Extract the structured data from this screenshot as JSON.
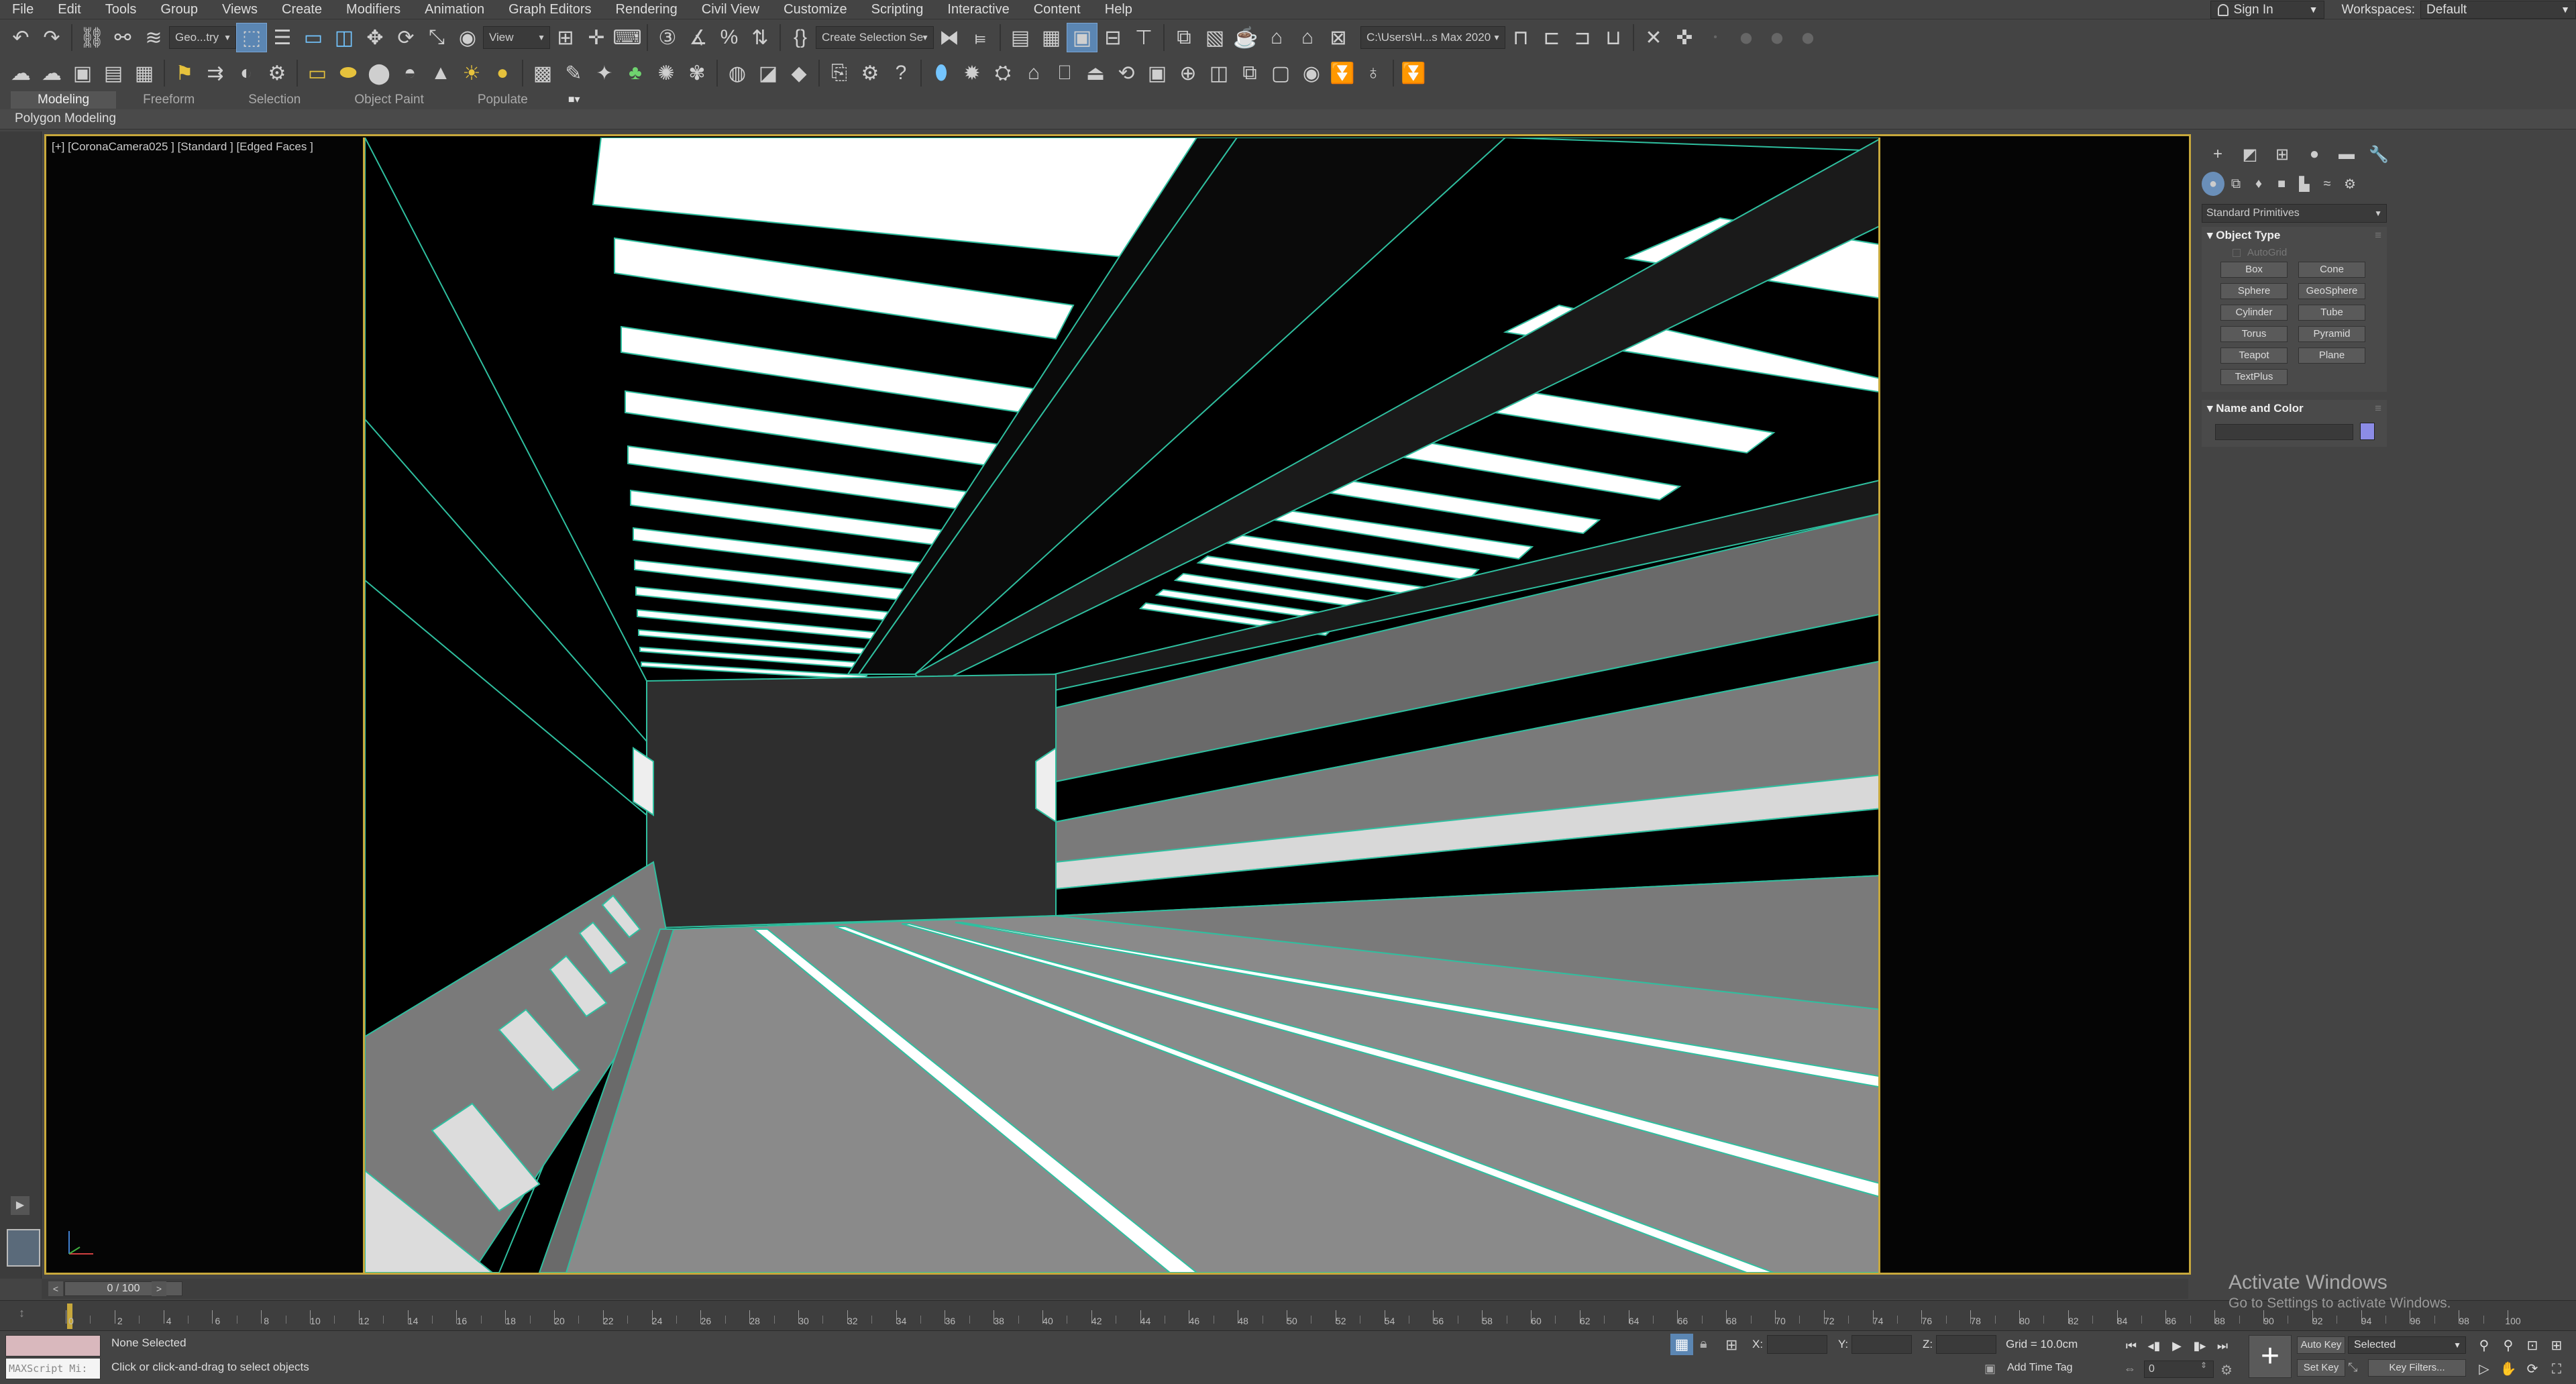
{
  "menubar": {
    "items": [
      "File",
      "Edit",
      "Tools",
      "Group",
      "Views",
      "Create",
      "Modifiers",
      "Animation",
      "Graph Editors",
      "Rendering",
      "Civil View",
      "Customize",
      "Scripting",
      "Interactive",
      "Content",
      "Help"
    ],
    "signin_label": "Sign In",
    "workspaces_label": "Workspaces:",
    "workspace_value": "Default"
  },
  "toolbar1": {
    "layer_select": "Geo...try",
    "refcoord_select": "View",
    "selection_set": "Create Selection Se",
    "project_path": "C:\\Users\\H...s Max 2020"
  },
  "ribbon": {
    "tabs": [
      "Modeling",
      "Freeform",
      "Selection",
      "Object Paint",
      "Populate"
    ],
    "active_tab": "Modeling",
    "toggle": "■▾",
    "polygon_label": "Polygon Modeling"
  },
  "viewport": {
    "label": "[+] [CoronaCamera025 ] [Standard ] [Edged Faces ]"
  },
  "command_panel": {
    "primitive_type": "Standard Primitives",
    "object_type": {
      "title": "Object Type",
      "autogrid": "AutoGrid",
      "buttons": [
        "Box",
        "Cone",
        "Sphere",
        "GeoSphere",
        "Cylinder",
        "Tube",
        "Torus",
        "Pyramid",
        "Teapot",
        "Plane",
        "TextPlus"
      ]
    },
    "name_color": {
      "title": "Name and Color",
      "swatch_color": "#8c8ce6"
    }
  },
  "timeline": {
    "frame_display": "0 / 100",
    "prev": "<",
    "next": ">",
    "ruler_labels": [
      "0",
      "2",
      "4",
      "6",
      "8",
      "10",
      "12",
      "14",
      "16",
      "18",
      "20",
      "22",
      "24",
      "26",
      "28",
      "30",
      "32",
      "34",
      "36",
      "38",
      "40",
      "42",
      "44",
      "46",
      "48",
      "50",
      "52",
      "54",
      "56",
      "58",
      "60",
      "62",
      "64",
      "66",
      "68",
      "70",
      "72",
      "74",
      "76",
      "78",
      "80",
      "82",
      "84",
      "86",
      "88",
      "90",
      "92",
      "94",
      "96",
      "98",
      "100"
    ]
  },
  "status": {
    "maxscript": "MAXScript Mi:",
    "selection": "None Selected",
    "hint": "Click or click-and-drag to select objects",
    "x_label": "X:",
    "y_label": "Y:",
    "z_label": "Z:",
    "grid": "Grid = 10.0cm",
    "add_time_tag": "Add Time Tag",
    "auto_key": "Auto Key",
    "set_key": "Set Key",
    "selected_dd": "Selected",
    "key_filters": "Key Filters...",
    "current_frame": "0"
  },
  "watermark": {
    "title": "Activate Windows",
    "subtitle": "Go to Settings to activate Windows."
  },
  "colors": {
    "accent": "#5b86b3",
    "viewport_border": "#c7a83c",
    "edge_teal": "#2fbf9f"
  }
}
